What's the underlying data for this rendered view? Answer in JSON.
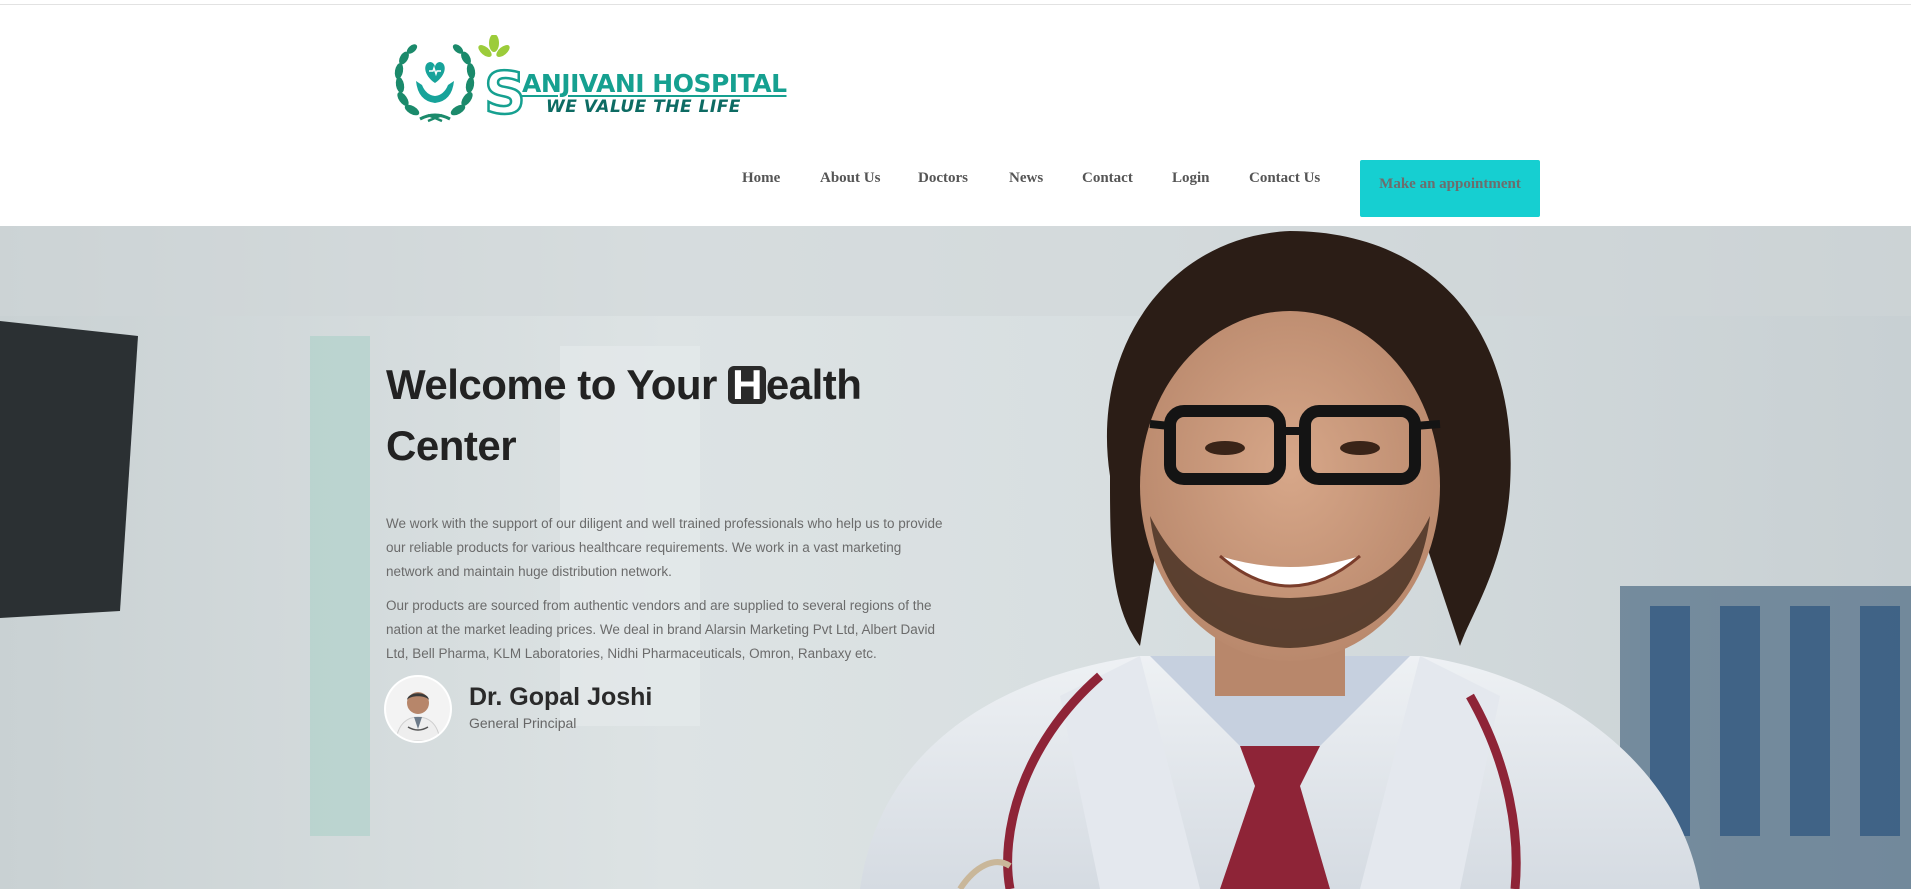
{
  "brand": {
    "name": "ANJIVANI HOSPITAL",
    "initial": "S",
    "tagline": "WE VALUE THE LIFE",
    "colors": {
      "teal": "#16a090",
      "dark_teal": "#0d6b63",
      "leaf_green": "#9ccc3a"
    }
  },
  "nav": {
    "items": [
      "Home",
      "About Us",
      "Doctors",
      "News",
      "Contact",
      "Login",
      "Contact Us"
    ],
    "cta_label": "Make an appointment",
    "cta_color": "#16cfd1"
  },
  "hero": {
    "title_start": "Welcome to Your ",
    "title_box_letter": "H",
    "title_rest": "ealth Center",
    "paragraph_1": "We work with the support of our diligent and well trained professionals who help us to provide our reliable products for various healthcare requirements. We work in a vast marketing network and maintain huge distribution network.",
    "paragraph_2": "Our products are sourced from authentic vendors and are supplied to several regions of the nation at the market leading prices. We deal in brand Alarsin Marketing Pvt Ltd, Albert David Ltd, Bell Pharma, KLM Laboratories, Nidhi Pharmaceuticals, Omron, Ranbaxy etc."
  },
  "doctor": {
    "name": "Dr. Gopal Joshi",
    "role": "General Principal"
  },
  "icons": {
    "logo_emblem": "wreath-hands-heart-icon",
    "hero_image": "smiling-doctor-photo"
  }
}
